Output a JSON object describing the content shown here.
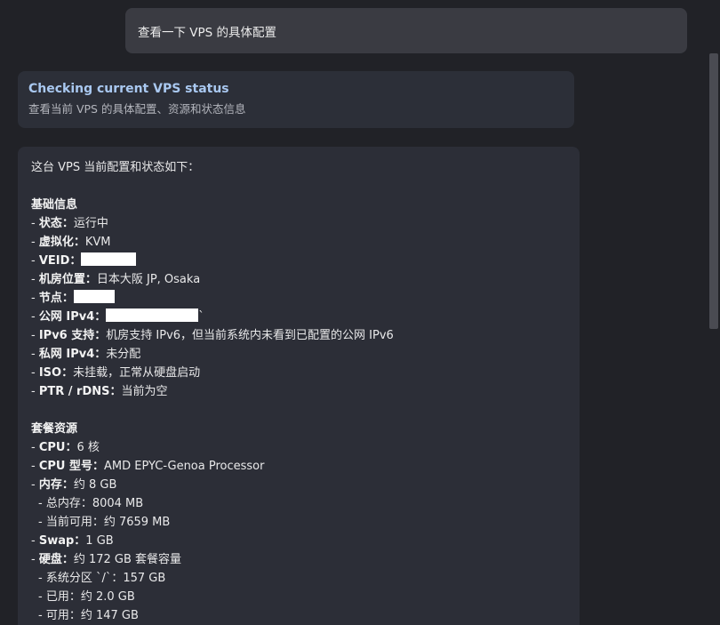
{
  "user_message": "查看一下 VPS 的具体配置",
  "status": {
    "title": "Checking current VPS status",
    "subtitle": "查看当前 VPS 的具体配置、资源和状态信息"
  },
  "reply": {
    "intro": "这台 VPS 当前配置和状态如下：",
    "basic": {
      "heading": "基础信息",
      "items": [
        {
          "label": "状态",
          "value": "运行中"
        },
        {
          "label": "虚拟化",
          "value": "KVM"
        },
        {
          "label": "VEID",
          "value": ""
        },
        {
          "label": "机房位置",
          "value": "日本大阪 JP, Osaka"
        },
        {
          "label": "节点",
          "value": ""
        },
        {
          "label": "公网 IPv4",
          "value": "`"
        },
        {
          "label": "IPv6 支持",
          "value": "机房支持 IPv6，但当前系统内未看到已配置的公网 IPv6"
        },
        {
          "label": "私网 IPv4",
          "value": "未分配"
        },
        {
          "label": "ISO",
          "value": "未挂载，正常从硬盘启动"
        },
        {
          "label": "PTR / rDNS",
          "value": "当前为空"
        }
      ]
    },
    "plan": {
      "heading": "套餐资源",
      "cpu": {
        "label": "CPU",
        "value": "6 核"
      },
      "cpu_model": {
        "label": "CPU 型号",
        "value": "AMD EPYC-Genoa Processor"
      },
      "memory": {
        "label": "内存",
        "value": "约 8 GB"
      },
      "memory_total": "- 总内存：8004 MB",
      "memory_available": "- 当前可用：约 7659 MB",
      "swap": {
        "label": "Swap",
        "value": "1 GB"
      },
      "disk": {
        "label": "硬盘",
        "value": "约 172 GB 套餐容量"
      },
      "disk_root": "- 系统分区 `/`：157 GB",
      "disk_used": "- 已用：约 2.0 GB",
      "disk_free": "- 可用：约 147 GB"
    }
  },
  "colors": {
    "background": "#212227",
    "user_bubble": "#3a3b42",
    "card": "#2c2e37",
    "status_title": "#a9c8f0"
  }
}
